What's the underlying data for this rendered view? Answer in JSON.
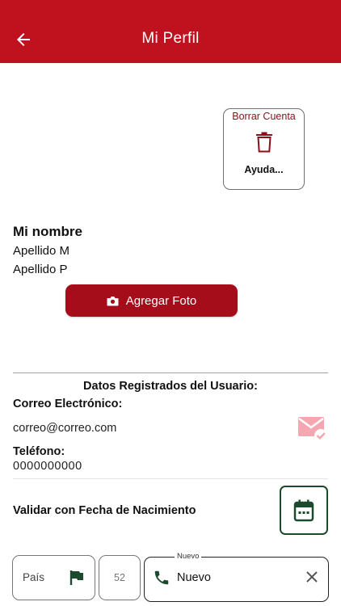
{
  "header": {
    "title": "Mi Perfil",
    "back_icon": "arrow-left-icon"
  },
  "account": {
    "delete_label": "Borrar Cuenta",
    "help_label": "Ayuda...",
    "trash_icon": "trash-icon"
  },
  "profile": {
    "name": "Mi nombre",
    "last_name_1": "Apellido M",
    "last_name_2": "Apellido P"
  },
  "photo_button": {
    "label": "Agregar Foto",
    "icon": "camera-icon"
  },
  "user_data": {
    "section_title": "Datos Registrados del Usuario:",
    "email_label": "Correo Electrónico:",
    "email_value": "correo@correo.com",
    "email_status_icon": "mail-check-icon",
    "phone_label": "Teléfono:",
    "phone_value": "0000000000"
  },
  "birth_validation": {
    "label": "Validar con Fecha de Nacimiento",
    "icon": "calendar-icon"
  },
  "phone_form": {
    "country_label": "País",
    "country_icon": "flag-icon",
    "country_code": "52",
    "phone_float_label": "Nuevo",
    "phone_value": "Nuevo",
    "phone_icon": "phone-icon",
    "clear_icon": "close-icon"
  },
  "colors": {
    "primary": "#c0111f",
    "button": "#a50d1a",
    "accent_green": "#1b4a2e",
    "email_icon": "#f4a7b0"
  }
}
